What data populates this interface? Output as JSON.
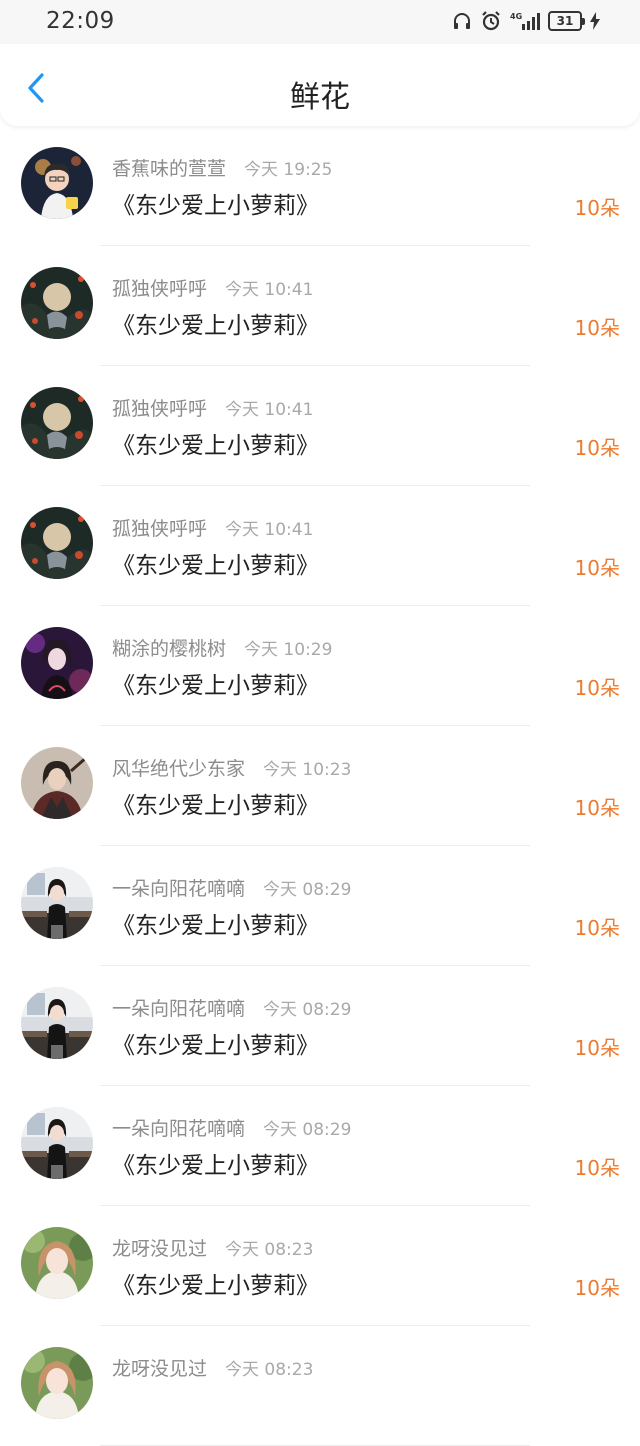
{
  "status": {
    "time": "22:09",
    "battery": "31",
    "network": "4G"
  },
  "header": {
    "title": "鲜花"
  },
  "items": [
    {
      "name": "香蕉味的萱萱",
      "time": "今天 19:25",
      "book": "《东少爱上小萝莉》",
      "flowers": "10朵",
      "avatar": "avatar-boy"
    },
    {
      "name": "孤独侠呼呼",
      "time": "今天 10:41",
      "book": "《东少爱上小萝莉》",
      "flowers": "10朵",
      "avatar": "avatar-moon"
    },
    {
      "name": "孤独侠呼呼",
      "time": "今天 10:41",
      "book": "《东少爱上小萝莉》",
      "flowers": "10朵",
      "avatar": "avatar-moon"
    },
    {
      "name": "孤独侠呼呼",
      "time": "今天 10:41",
      "book": "《东少爱上小萝莉》",
      "flowers": "10朵",
      "avatar": "avatar-moon"
    },
    {
      "name": "糊涂的樱桃树",
      "time": "今天 10:29",
      "book": "《东少爱上小萝莉》",
      "flowers": "10朵",
      "avatar": "avatar-purple"
    },
    {
      "name": "风华绝代少东家",
      "time": "今天 10:23",
      "book": "《东少爱上小萝莉》",
      "flowers": "10朵",
      "avatar": "avatar-warrior"
    },
    {
      "name": "一朵向阳花嘀嘀",
      "time": "今天 08:29",
      "book": "《东少爱上小萝莉》",
      "flowers": "10朵",
      "avatar": "avatar-classroom"
    },
    {
      "name": "一朵向阳花嘀嘀",
      "time": "今天 08:29",
      "book": "《东少爱上小萝莉》",
      "flowers": "10朵",
      "avatar": "avatar-classroom"
    },
    {
      "name": "一朵向阳花嘀嘀",
      "time": "今天 08:29",
      "book": "《东少爱上小萝莉》",
      "flowers": "10朵",
      "avatar": "avatar-classroom"
    },
    {
      "name": "龙呀没见过",
      "time": "今天 08:23",
      "book": "《东少爱上小萝莉》",
      "flowers": "10朵",
      "avatar": "avatar-girl"
    },
    {
      "name": "龙呀没见过",
      "time": "今天 08:23",
      "book": "",
      "flowers": "",
      "avatar": "avatar-girl"
    }
  ],
  "colors": {
    "accent_back": "#2196f3",
    "flowers": "#ee7a2b"
  }
}
